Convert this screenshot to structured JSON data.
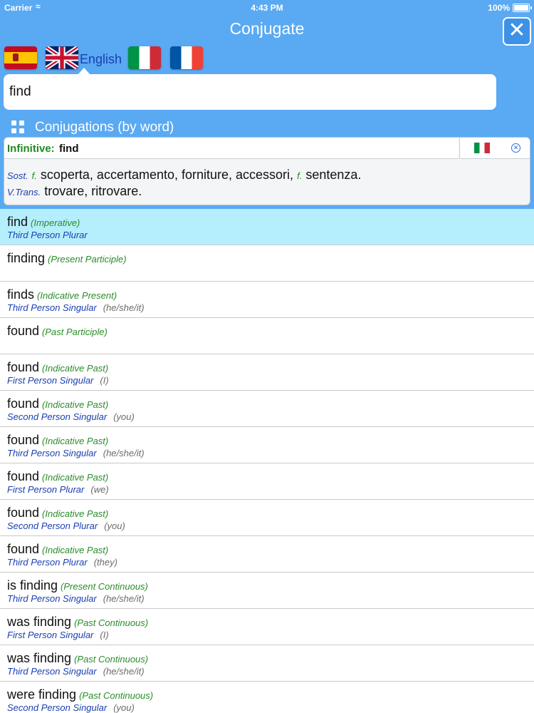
{
  "status_bar": {
    "carrier": "Carrier",
    "time": "4:43 PM",
    "battery": "100%"
  },
  "nav": {
    "title": "Conjugate",
    "close_icon": "close-x-icon"
  },
  "languages": {
    "selected_label": "English",
    "flags": [
      "spain-flag-icon",
      "uk-flag-icon",
      "italy-flag-icon",
      "france-flag-icon"
    ]
  },
  "search": {
    "value": "find"
  },
  "section": {
    "title": "Conjugations (by word)",
    "icon": "grid-icon"
  },
  "definition": {
    "infinitive_label": "Infinitive:",
    "infinitive_word": "find",
    "line1": {
      "pos": "Sost.",
      "gender1": "f.",
      "text1": "scoperta, accertamento, forniture, accessori,",
      "gender2": "f.",
      "text2": "sentenza."
    },
    "line2": {
      "pos": "V.Trans.",
      "text": "trovare, ritrovare."
    }
  },
  "conjugations": [
    {
      "word": "find",
      "tense": "(Imperative)",
      "person": "Third Person Plurar",
      "pronoun": "",
      "selected": true
    },
    {
      "word": "finding",
      "tense": "(Present Participle)",
      "person": "",
      "pronoun": ""
    },
    {
      "word": "finds",
      "tense": "(Indicative Present)",
      "person": "Third Person Singular",
      "pronoun": "(he/she/it)"
    },
    {
      "word": "found",
      "tense": "(Past Participle)",
      "person": "",
      "pronoun": ""
    },
    {
      "word": "found",
      "tense": "(Indicative Past)",
      "person": "First Person Singular",
      "pronoun": "(I)"
    },
    {
      "word": "found",
      "tense": "(Indicative Past)",
      "person": "Second Person Singular",
      "pronoun": "(you)"
    },
    {
      "word": "found",
      "tense": "(Indicative Past)",
      "person": "Third Person Singular",
      "pronoun": "(he/she/it)"
    },
    {
      "word": "found",
      "tense": "(Indicative Past)",
      "person": "First Person Plurar",
      "pronoun": "(we)"
    },
    {
      "word": "found",
      "tense": "(Indicative Past)",
      "person": "Second Person Plurar",
      "pronoun": "(you)"
    },
    {
      "word": "found",
      "tense": "(Indicative Past)",
      "person": "Third Person Plurar",
      "pronoun": "(they)"
    },
    {
      "word": "is finding",
      "tense": "(Present Continuous)",
      "person": "Third Person Singular",
      "pronoun": "(he/she/it)"
    },
    {
      "word": "was finding",
      "tense": "(Past Continuous)",
      "person": "First Person Singular",
      "pronoun": "(I)"
    },
    {
      "word": "was finding",
      "tense": "(Past Continuous)",
      "person": "Third Person Singular",
      "pronoun": "(he/she/it)"
    },
    {
      "word": "were finding",
      "tense": "(Past Continuous)",
      "person": "Second Person Singular",
      "pronoun": "(you)"
    }
  ],
  "colors": {
    "background": "#5aa9f3",
    "selected_row": "#b5eefc",
    "tense_green": "#2a8c2a",
    "person_blue": "#1a3fb0"
  }
}
